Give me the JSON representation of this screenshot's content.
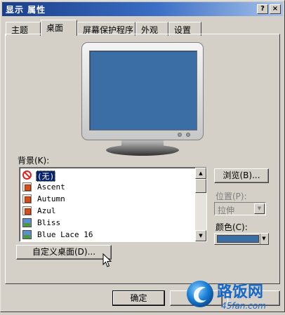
{
  "window": {
    "title": "显示 属性"
  },
  "titlebar": {
    "help": "?",
    "close": "×"
  },
  "tabs": [
    {
      "label": "主题"
    },
    {
      "label": "桌面"
    },
    {
      "label": "屏幕保护程序"
    },
    {
      "label": "外观"
    },
    {
      "label": "设置"
    }
  ],
  "active_tab": "桌面",
  "background": {
    "label": "背景(K):",
    "items": [
      {
        "label": "(无)",
        "icon": "no-entry-icon",
        "selected": true
      },
      {
        "label": "Ascent",
        "icon": "image-file-icon"
      },
      {
        "label": "Autumn",
        "icon": "image-file-icon"
      },
      {
        "label": "Azul",
        "icon": "image-file-icon"
      },
      {
        "label": "Bliss",
        "icon": "bitmap-file-icon"
      },
      {
        "label": "Blue Lace 16",
        "icon": "bitmap-file-icon"
      }
    ]
  },
  "browse_button": "浏览(B)...",
  "position": {
    "label": "位置(P):",
    "value": "拉伸"
  },
  "color": {
    "label": "颜色(C):",
    "value": "#3a6ea5"
  },
  "customize_button": "自定义桌面(D)...",
  "footer": {
    "ok_button": "确定"
  },
  "watermark": {
    "brand": "路饭网",
    "domain": "45fan.com"
  }
}
